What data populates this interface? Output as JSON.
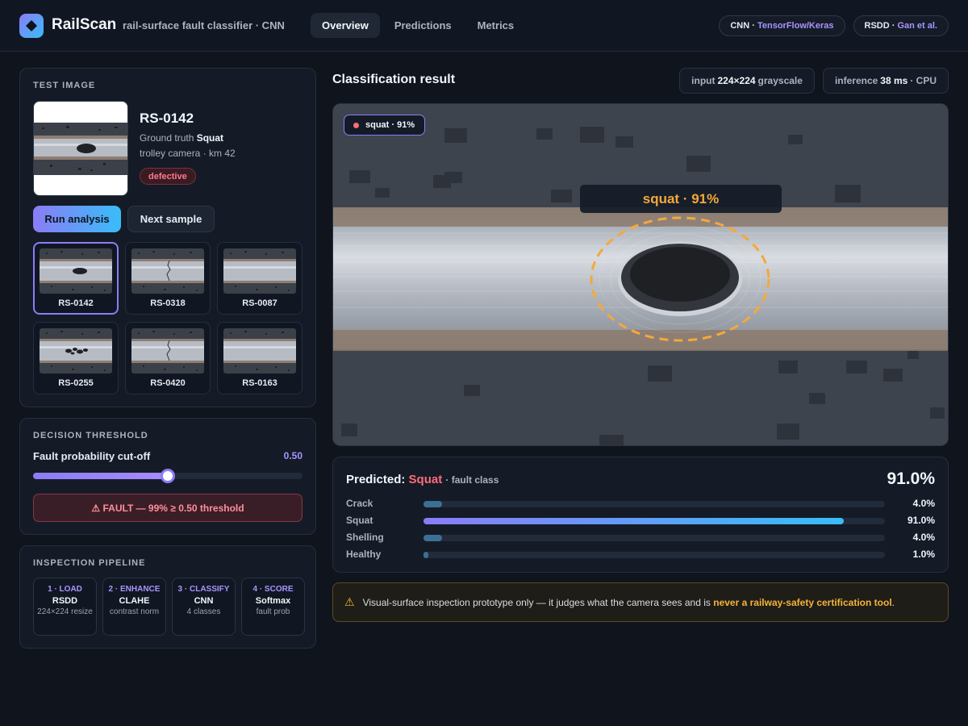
{
  "header": {
    "app_name": "RailScan",
    "app_subtitle": "rail-surface fault classifier · CNN",
    "logo_icon": "diamond-icon",
    "tabs": [
      {
        "label": "Overview",
        "active": true
      },
      {
        "label": "Predictions",
        "active": false
      },
      {
        "label": "Metrics",
        "active": false
      }
    ],
    "chips": [
      {
        "key": "CNN",
        "value": "TensorFlow/Keras"
      },
      {
        "key": "RSDD",
        "value": "Gan et al."
      }
    ]
  },
  "test_image": {
    "title": "TEST IMAGE",
    "sample_id": "RS-0142",
    "ground_truth_label": "Ground truth",
    "ground_truth_value": "Squat",
    "source": "trolley camera · km 42",
    "status_badge": "defective",
    "run_button": "Run analysis",
    "next_button": "Next sample",
    "samples": [
      {
        "id": "RS-0142",
        "kind": "squat",
        "selected": true
      },
      {
        "id": "RS-0318",
        "kind": "crack",
        "selected": false
      },
      {
        "id": "RS-0087",
        "kind": "healthy",
        "selected": false
      },
      {
        "id": "RS-0255",
        "kind": "shelling",
        "selected": false
      },
      {
        "id": "RS-0420",
        "kind": "crack",
        "selected": false
      },
      {
        "id": "RS-0163",
        "kind": "healthy",
        "selected": false
      }
    ]
  },
  "threshold": {
    "title": "DECISION THRESHOLD",
    "label": "Fault probability cut-off",
    "value_text": "0.50",
    "value": 0.5,
    "alert_icon": "warning-icon",
    "alert": "⚠ FAULT — 99% ≥ 0.50 threshold"
  },
  "pipeline": {
    "title": "INSPECTION PIPELINE",
    "steps": [
      {
        "head": "1 · LOAD",
        "name": "RSDD",
        "desc": "224×224 resize"
      },
      {
        "head": "2 · ENHANCE",
        "name": "CLAHE",
        "desc": "contrast norm"
      },
      {
        "head": "3 · CLASSIFY",
        "name": "CNN",
        "desc": "4 classes"
      },
      {
        "head": "4 · SCORE",
        "name": "Softmax",
        "desc": "fault prob"
      }
    ]
  },
  "result": {
    "title": "Classification result",
    "input_chip": {
      "prefix": "input",
      "value": "224×224",
      "suffix": "grayscale"
    },
    "inference_chip": {
      "prefix": "inference",
      "value": "38 ms",
      "suffix": "· CPU"
    },
    "overlay_chip": "squat · 91%",
    "detection_label": "squat · 91%"
  },
  "prediction": {
    "prefix": "Predicted:",
    "class": "Squat",
    "suffix": "· fault class",
    "confidence": "91.0%",
    "classes": [
      {
        "name": "Crack",
        "prob": 0.04,
        "text": "4.0%",
        "top": false
      },
      {
        "name": "Squat",
        "prob": 0.91,
        "text": "91.0%",
        "top": true
      },
      {
        "name": "Shelling",
        "prob": 0.04,
        "text": "4.0%",
        "top": false
      },
      {
        "name": "Healthy",
        "prob": 0.01,
        "text": "1.0%",
        "top": false
      }
    ]
  },
  "warning": {
    "icon": "warning-icon",
    "text": "Visual-surface inspection prototype only — it judges what the camera sees and is",
    "highlight": "never a railway-safety certification tool",
    "end": "."
  },
  "colors": {
    "accent": "#8b7cf6",
    "accent_2": "#38bdf8",
    "fault": "#ff6b7a",
    "detection": "#f5a83a"
  }
}
